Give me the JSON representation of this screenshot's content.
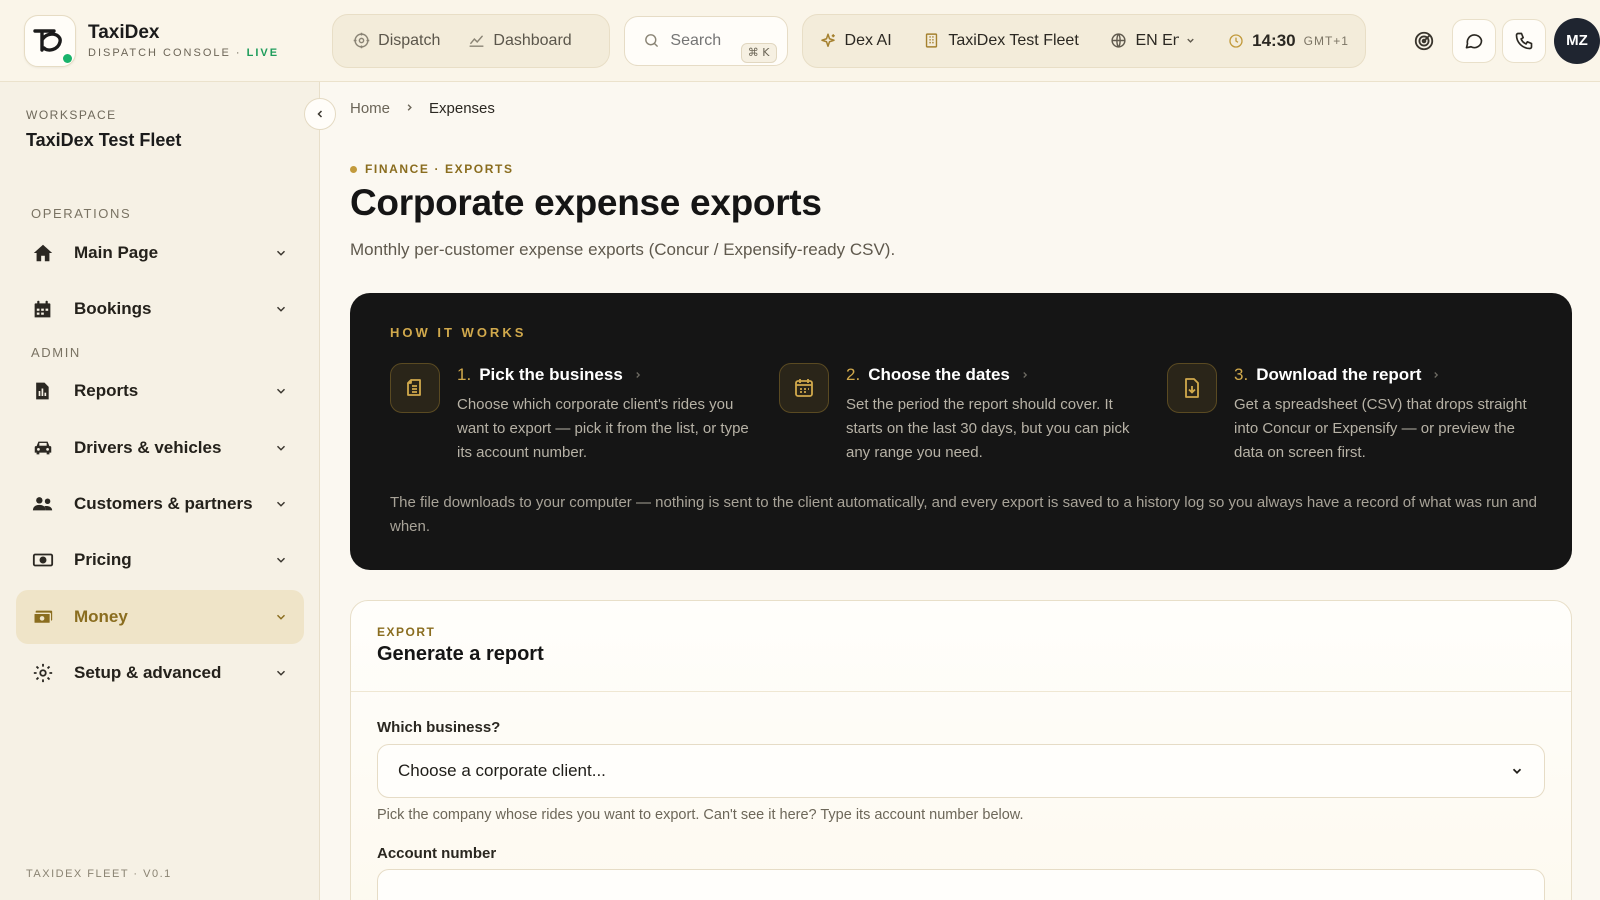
{
  "brand": {
    "name": "TaxiDex",
    "subtitle": "DISPATCH CONSOLE",
    "separator": "·",
    "live": "LIVE"
  },
  "topnav": {
    "dispatch": "Dispatch",
    "dashboard": "Dashboard"
  },
  "search": {
    "placeholder": "Search",
    "shortcut": "⌘ K"
  },
  "context": {
    "ai": "Dex AI",
    "fleet": "TaxiDex Test Fleet",
    "language": "EN English",
    "time": "14:30",
    "timezone": "GMT+1"
  },
  "user": {
    "initials": "MZ"
  },
  "sidebar": {
    "workspace_label": "WORKSPACE",
    "workspace_name": "TaxiDex Test Fleet",
    "sections": {
      "operations": "OPERATIONS",
      "admin": "ADMIN"
    },
    "items": [
      {
        "label": "Main Page",
        "icon": "home-icon"
      },
      {
        "label": "Bookings",
        "icon": "calendar-icon"
      },
      {
        "label": "Reports",
        "icon": "document-icon"
      },
      {
        "label": "Drivers & vehicles",
        "icon": "car-icon"
      },
      {
        "label": "Customers & partners",
        "icon": "users-icon"
      },
      {
        "label": "Pricing",
        "icon": "cash-icon"
      },
      {
        "label": "Money",
        "icon": "money-icon",
        "active": true
      },
      {
        "label": "Setup & advanced",
        "icon": "settings-icon"
      }
    ],
    "footer": "TAXIDEX FLEET · V0.1"
  },
  "breadcrumb": {
    "home": "Home",
    "current": "Expenses"
  },
  "page": {
    "eyebrow": "FINANCE · EXPORTS",
    "title": "Corporate expense exports",
    "description": "Monthly per-customer expense exports (Concur / Expensify-ready CSV)."
  },
  "how": {
    "label": "HOW IT WORKS",
    "steps": [
      {
        "num": "1.",
        "title": "Pick the business",
        "text": "Choose which corporate client's rides you want to export — pick it from the list, or type its account number."
      },
      {
        "num": "2.",
        "title": "Choose the dates",
        "text": "Set the period the report should cover. It starts on the last 30 days, but you can pick any range you need."
      },
      {
        "num": "3.",
        "title": "Download the report",
        "text": "Get a spreadsheet (CSV) that drops straight into Concur or Expensify — or preview the data on screen first."
      }
    ],
    "footer": "The file downloads to your computer — nothing is sent to the client automatically, and every export is saved to a history log so you always have a record of what was run and when."
  },
  "export": {
    "eyebrow": "EXPORT",
    "title": "Generate a report",
    "business_label": "Which business?",
    "business_selected": "Choose a corporate client...",
    "business_hint": "Pick the company whose rides you want to export. Can't see it here? Type its account number below.",
    "account_label": "Account number",
    "account_value": ""
  },
  "colors": {
    "accent": "#c29a3c",
    "accent_text": "#8a6d1f",
    "dark_card": "#151515",
    "live": "#1f9d5c"
  }
}
